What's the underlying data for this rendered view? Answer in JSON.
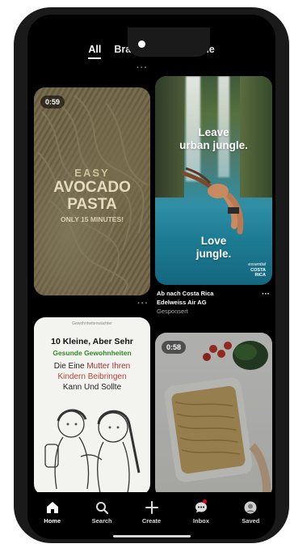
{
  "tabs": [
    {
      "label": "All",
      "active": true
    },
    {
      "label": "Branding",
      "active": false
    },
    {
      "label": "Storyline",
      "active": false
    }
  ],
  "pins": {
    "pasta": {
      "duration": "0:59",
      "line1": "EASY",
      "line2": "AVOCADO",
      "line3": "PASTA",
      "line4": "ONLY 15 MINUTES!"
    },
    "ad": {
      "headline1": "Leave",
      "headline2": "urban jungle.",
      "tagline1": "Love",
      "tagline2": "jungle.",
      "logo_line1": "essential",
      "logo_line2": "COSTA",
      "logo_line3": "RICA",
      "title": "Ab nach Costa Rica",
      "advertiser": "Edelweiss Air AG",
      "sponsored": "Gesponsert"
    },
    "manga": {
      "caption": "Gewohnheitenwächter",
      "line1": "10 Kleine, Aber Sehr",
      "line2": "Gesunde Gewohnheiten",
      "line3a": "Die Eine ",
      "line3b": "Mutter Ihren",
      "line4": "Kindern Beibringen",
      "line5": "Kann Und Sollte"
    },
    "food": {
      "duration": "0:58"
    }
  },
  "nav": [
    {
      "label": "Home",
      "icon": "home-icon",
      "active": true
    },
    {
      "label": "Search",
      "icon": "search-icon",
      "active": false
    },
    {
      "label": "Create",
      "icon": "plus-icon",
      "active": false
    },
    {
      "label": "Inbox",
      "icon": "chat-icon",
      "active": false,
      "notification": true
    },
    {
      "label": "Saved",
      "icon": "avatar-icon",
      "active": false
    }
  ],
  "colors": {
    "background": "#000000",
    "accent_red": "#e60023",
    "tab_underline": "#ffffff"
  }
}
